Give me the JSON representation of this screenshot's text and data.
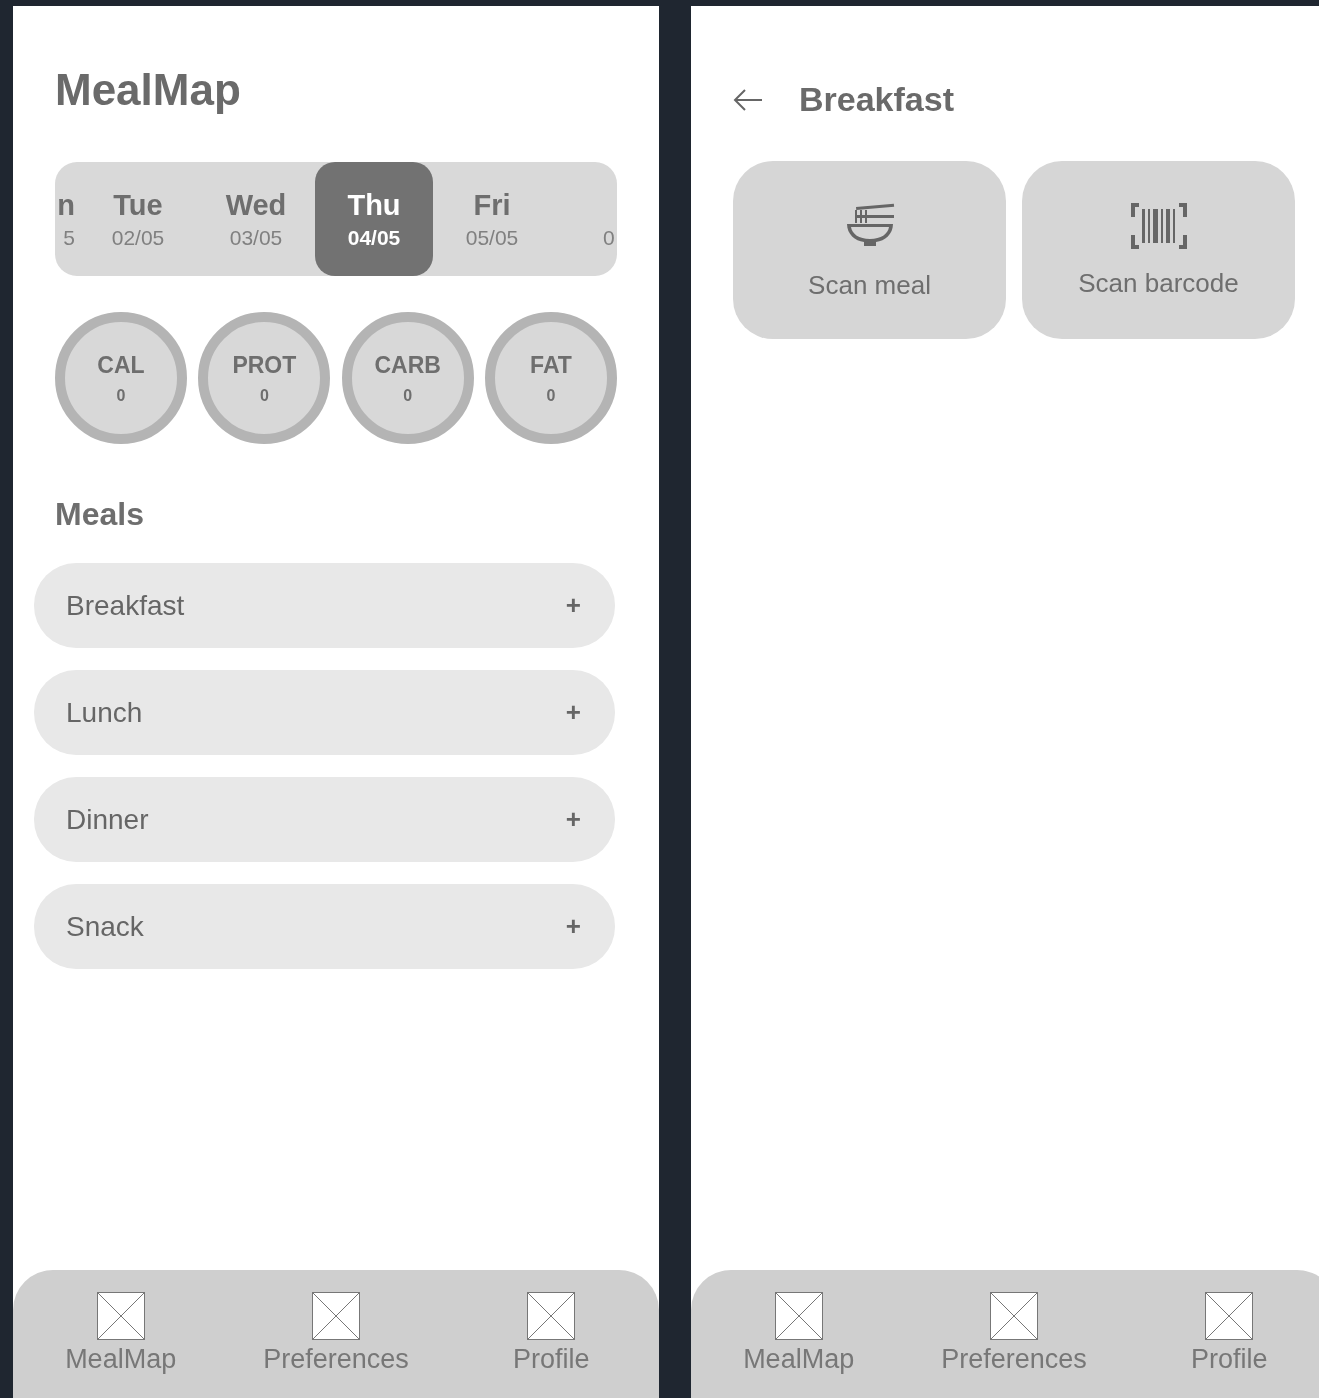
{
  "home": {
    "title": "MealMap",
    "days": [
      {
        "kind": "cutstart",
        "day": "n",
        "date": "5",
        "selected": false
      },
      {
        "kind": "full",
        "day": "Tue",
        "date": "02/05",
        "selected": false
      },
      {
        "kind": "full",
        "day": "Wed",
        "date": "03/05",
        "selected": false
      },
      {
        "kind": "full",
        "day": "Thu",
        "date": "04/05",
        "selected": true
      },
      {
        "kind": "full",
        "day": "Fri",
        "date": "05/05",
        "selected": false
      },
      {
        "kind": "cutend",
        "date": "0",
        "selected": false
      }
    ],
    "macros": [
      {
        "label": "CAL",
        "value": "0"
      },
      {
        "label": "PROT",
        "value": "0"
      },
      {
        "label": "CARB",
        "value": "0"
      },
      {
        "label": "FAT",
        "value": "0"
      }
    ],
    "meals_heading": "Meals",
    "meals": [
      {
        "name": "Breakfast",
        "action": "+"
      },
      {
        "name": "Lunch",
        "action": "+"
      },
      {
        "name": "Dinner",
        "action": "+"
      },
      {
        "name": "Snack",
        "action": "+"
      }
    ],
    "nav": [
      {
        "label": "MealMap"
      },
      {
        "label": "Preferences"
      },
      {
        "label": "Profile"
      }
    ]
  },
  "detail": {
    "title": "Breakfast",
    "actions": [
      {
        "label": "Scan meal",
        "kind": "meal"
      },
      {
        "label": "Scan barcode",
        "kind": "barcode"
      }
    ],
    "nav": [
      {
        "label": "MealMap"
      },
      {
        "label": "Preferences"
      },
      {
        "label": "Profile"
      }
    ]
  }
}
